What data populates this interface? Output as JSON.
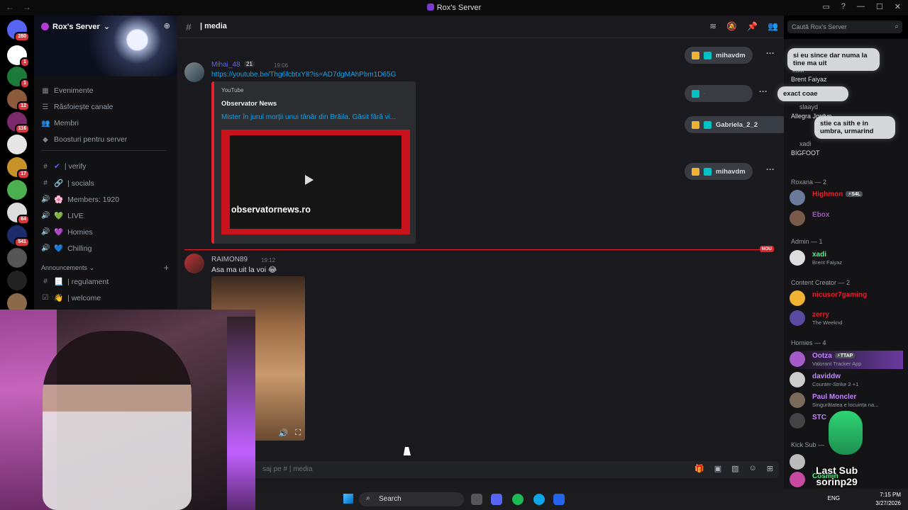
{
  "window": {
    "title": "Rox's Server",
    "nav_back": "←",
    "nav_fwd": "→"
  },
  "server": {
    "name": "Rox's Server"
  },
  "rail_badges": [
    "280",
    "1",
    "1",
    "12",
    "116",
    "17",
    "64",
    "541"
  ],
  "sidebar": {
    "items": [
      {
        "label": "Evenimente",
        "icon": "calendar-icon"
      },
      {
        "label": "Răsfoiește canale",
        "icon": "browse-icon"
      },
      {
        "label": "Membri",
        "icon": "members-icon"
      },
      {
        "label": "Boosturi pentru server",
        "icon": "boost-icon"
      }
    ],
    "channels": [
      {
        "label": "| verify",
        "emoji": "✔"
      },
      {
        "label": "| socials",
        "emoji": "🔗"
      },
      {
        "label": "Members: 1920",
        "emoji": "🌸"
      },
      {
        "label": "LIVE",
        "emoji": "💚"
      },
      {
        "label": "Homies",
        "emoji": "💜"
      },
      {
        "label": "Chilling",
        "emoji": "💙"
      }
    ],
    "category": "Announcements",
    "category_channels": [
      {
        "label": "| regulament",
        "emoji": "📃"
      },
      {
        "label": "| welcome",
        "emoji": "👋"
      }
    ]
  },
  "header": {
    "channel": "| media",
    "search_placeholder": "Caută Rox's Server"
  },
  "messages": [
    {
      "author": "Mihai_48",
      "badge": "21",
      "time": "19:06",
      "link": "https://youtube.be/Thg6fcbtxY8?is=AD7dgMAhPbm1D65G",
      "embed": {
        "provider": "YouTube",
        "name": "Observator News",
        "title": "Mister în jurul morții unui tânăr din Brăila. Găsit fără vi...",
        "watermark": "observatornews.ro"
      }
    },
    {
      "author": "RAIMON89",
      "time": "19:12",
      "text": "Asa ma uit la voi 😂"
    }
  ],
  "new_badge": "NOU",
  "composer": {
    "placeholder": "saj pe #",
    "channel": "| media"
  },
  "overlay_pills": [
    {
      "name": "mihavdm"
    },
    {
      "name": "Gabriela_2_2"
    },
    {
      "name": "mihavdm"
    }
  ],
  "bubbles": [
    "si eu since dar numa la tine ma uit",
    "exact coae",
    "stie ca sith e in umbra, urmarind"
  ],
  "overlay_names": [
    {
      "name": "xadi",
      "sub": "Brent Faiyaz"
    },
    {
      "name": "slaayd",
      "sub": "Allegra Jordyn"
    },
    {
      "name": "xadi",
      "sub": "BIGFOOT"
    }
  ],
  "member_groups": [
    {
      "title": "Roxana — 2"
    },
    {
      "title": "Admin — 1"
    },
    {
      "title": "Content Creator — 2"
    },
    {
      "title": "Homies — 4"
    },
    {
      "title": "Kick Sub —"
    }
  ],
  "members": [
    {
      "name": "Highmon",
      "tag": "⚡S4L",
      "status": "",
      "color": "#e5212e"
    },
    {
      "name": "Ebox",
      "tag": "",
      "status": "",
      "color": "#9b59b6"
    },
    {
      "name": "xadi",
      "tag": "",
      "status": "Brent Faiyaz",
      "color": "#57f287"
    },
    {
      "name": "nicusor7gaming",
      "tag": "",
      "status": "",
      "color": "#e5212e"
    },
    {
      "name": "zerry",
      "tag": "",
      "status": "The Weeknd",
      "color": "#e5212e"
    },
    {
      "name": "Ootza",
      "tag": "⚡TTAP",
      "status": "Valorant Tracker App",
      "color": "#c084fc"
    },
    {
      "name": "daviddw",
      "tag": "",
      "status": "Counter-Strike 2 +1",
      "color": "#c084fc"
    },
    {
      "name": "Paul Moncler",
      "tag": "",
      "status": "Singurătatea e locuința na...",
      "color": "#c084fc"
    },
    {
      "name": "STC",
      "tag": "",
      "status": "",
      "color": "#c084fc"
    },
    {
      "name": "Cosmin",
      "tag": "",
      "status": "",
      "color": "#57f287"
    }
  ],
  "last_sub": {
    "label": "Last Sub",
    "name": "sorinp29"
  },
  "taskbar": {
    "search": "Search",
    "lang": "ENG",
    "time": "7:15 PM",
    "date": "3/27/2026"
  },
  "colors": {
    "accent": "#5865f2",
    "danger": "#e5212e",
    "link": "#00a8fc"
  }
}
